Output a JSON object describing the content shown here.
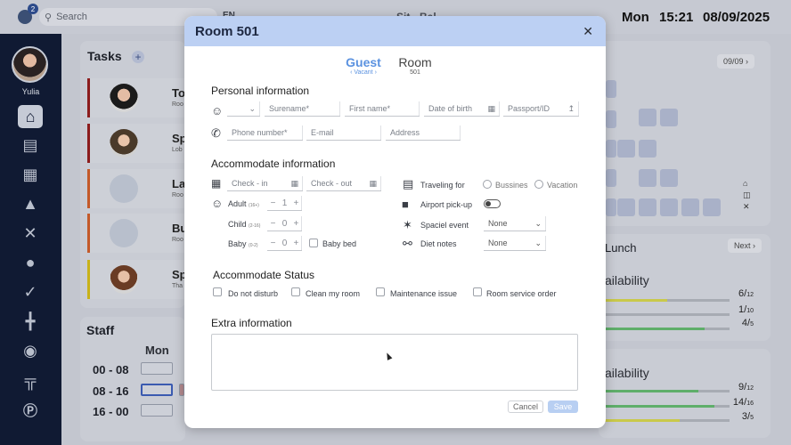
{
  "topbar": {
    "notification_count": "2",
    "search_placeholder": "Search",
    "language": "EN",
    "app_title": "Sit · Bal",
    "day": "Mon",
    "time": "15:21",
    "date": "08/09/2025"
  },
  "sidebar": {
    "user_name": "Yulia",
    "items": [
      "home-icon",
      "bed-icon",
      "calendar-icon",
      "spray-icon",
      "tools-icon",
      "dish-icon",
      "champagne-icon",
      "dumbbell-icon",
      "spa-stones-icon",
      "restaurant-table-icon",
      "parking-icon"
    ]
  },
  "tasks_panel": {
    "title": "Tasks",
    "rows": [
      {
        "text": "To",
        "sub": "Roo",
        "color": "#8c1d1d"
      },
      {
        "text": "Sp",
        "sub": "Lob",
        "color": "#8c1d1d"
      },
      {
        "text": "La",
        "sub": "Roo",
        "color": "#c45a2a"
      },
      {
        "text": "Bu",
        "sub": "Roo",
        "color": "#c45a2a"
      },
      {
        "text": "Sp",
        "sub": "Tha",
        "color": "#c8b21a"
      }
    ]
  },
  "staff_panel": {
    "title": "Staff",
    "day": "Mon",
    "shifts": [
      "00 - 08",
      "08 - 16",
      "16 - 00"
    ]
  },
  "right_panel": {
    "page_indicator": "09/09",
    "lunch_title": "Lunch",
    "next_label": "Next",
    "availability_1": {
      "label": "ailability",
      "rows": [
        {
          "num": "6",
          "den": "12",
          "fill": 0.5,
          "color": "#c9c94a"
        },
        {
          "num": "1",
          "den": "10",
          "fill": 0.1,
          "color": "#a7abb3"
        },
        {
          "num": "4",
          "den": "5",
          "fill": 0.8,
          "color": "#5fae6a"
        }
      ]
    },
    "availability_2": {
      "label": "ailability",
      "rows": [
        {
          "num": "9",
          "den": "12",
          "fill": 0.75,
          "color": "#5fae6a"
        },
        {
          "num": "14",
          "den": "16",
          "fill": 0.875,
          "color": "#5fae6a"
        },
        {
          "num": "3",
          "den": "5",
          "fill": 0.6,
          "color": "#c9c94a"
        }
      ]
    }
  },
  "modal": {
    "title": "Room 501",
    "tabs": {
      "guest": {
        "label": "Guest",
        "sub": "‹ Vacant ›"
      },
      "room": {
        "label": "Room",
        "sub": "501"
      }
    },
    "personal": {
      "title": "Personal information",
      "surname": "Surename*",
      "first_name": "First name*",
      "dob": "Date of birth",
      "passport": "Passport/ID",
      "phone": "Phone number*",
      "email": "E-mail",
      "address": "Address"
    },
    "accommodate": {
      "title": "Accommodate information",
      "checkin": "Check - in",
      "checkout": "Check - out",
      "adult_label": "Adult",
      "adult_range": "(16+)",
      "adult_value": "1",
      "child_label": "Child",
      "child_range": "(2-16)",
      "child_value": "0",
      "baby_label": "Baby",
      "baby_range": "(0-2)",
      "baby_value": "0",
      "baby_bed": "Baby bed",
      "traveling_for": "Traveling for",
      "business": "Bussines",
      "vacation": "Vacation",
      "airport_pickup": "Airport pick-up",
      "special_event": "Spaciel event",
      "special_event_value": "None",
      "diet_notes": "Diet notes",
      "diet_value": "None"
    },
    "status": {
      "title": "Accommodate Status",
      "dnd": "Do not disturb",
      "clean": "Clean my room",
      "maintenance": "Maintenance issue",
      "room_service": "Room service order"
    },
    "extra": {
      "title": "Extra information"
    },
    "cancel": "Cancel",
    "save": "Save"
  }
}
